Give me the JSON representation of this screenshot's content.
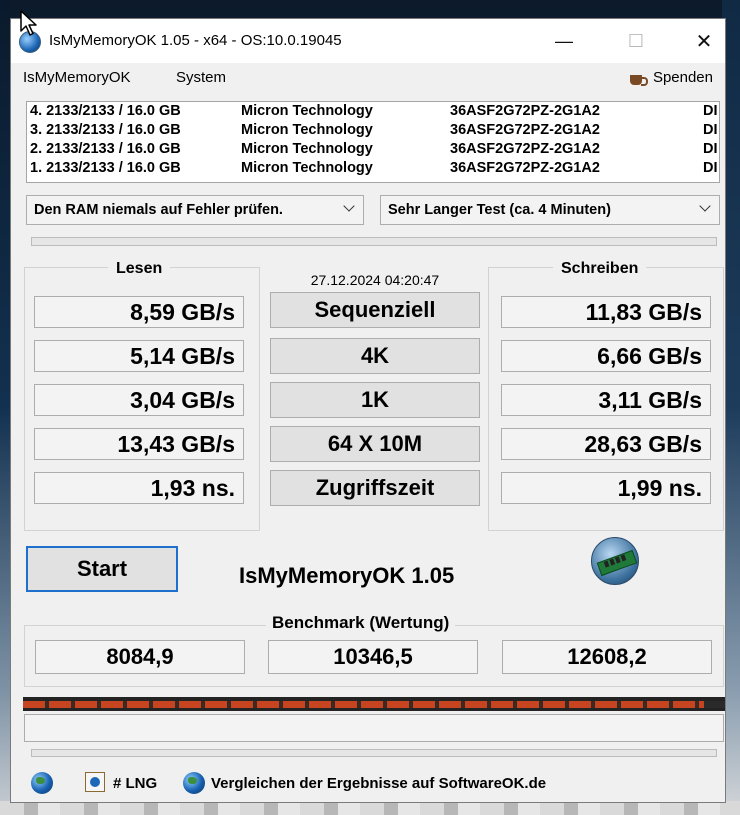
{
  "window": {
    "title": "IsMyMemoryOK 1.05 - x64 - OS:10.0.19045",
    "minimize": "—",
    "maximize": "☐",
    "close": "✕"
  },
  "menu": {
    "items": [
      "IsMyMemoryOK",
      "System"
    ],
    "donate": "Spenden"
  },
  "ram_modules": [
    {
      "slot": "4. 2133/2133 / 16.0 GB",
      "vendor": "Micron Technology",
      "part": "36ASF2G72PZ-2G1A2",
      "extra": "DI"
    },
    {
      "slot": "3. 2133/2133 / 16.0 GB",
      "vendor": "Micron Technology",
      "part": "36ASF2G72PZ-2G1A2",
      "extra": "DI"
    },
    {
      "slot": "2. 2133/2133 / 16.0 GB",
      "vendor": "Micron Technology",
      "part": "36ASF2G72PZ-2G1A2",
      "extra": "DI"
    },
    {
      "slot": "1. 2133/2133 / 16.0 GB",
      "vendor": "Micron Technology",
      "part": "36ASF2G72PZ-2G1A2",
      "extra": "DI"
    }
  ],
  "selects": {
    "error_check": "Den RAM niemals auf Fehler prüfen.",
    "test_length": "Sehr Langer Test (ca. 4 Minuten)"
  },
  "timestamp": "27.12.2024 04:20:47",
  "read": {
    "label": "Lesen",
    "values": [
      "8,59 GB/s",
      "5,14 GB/s",
      "3,04 GB/s",
      "13,43 GB/s",
      "1,93 ns."
    ]
  },
  "write": {
    "label": "Schreiben",
    "values": [
      "11,83 GB/s",
      "6,66 GB/s",
      "3,11 GB/s",
      "28,63 GB/s",
      "1,99 ns."
    ]
  },
  "tests": [
    "Sequenziell",
    "4K",
    "1K",
    "64 X 10M",
    "Zugriffszeit"
  ],
  "start_label": "Start",
  "app_name": "IsMyMemoryOK 1.05",
  "benchmark": {
    "label": "Benchmark (Wertung)",
    "values": [
      "8084,9",
      "10346,5",
      "12608,2"
    ]
  },
  "progress": {
    "led_fill_fraction": 0.97
  },
  "footer": {
    "lng": "# LNG",
    "compare": "Vergleichen der Ergebnisse auf SoftwareOK.de"
  },
  "colors": {
    "led": "#c74420",
    "focus": "#1f6fcf"
  },
  "icons": {
    "app": "memory-chip-globe-icon",
    "donate": "coffee-cup-icon",
    "footer_left": "globe-icon",
    "lng": "language-icon",
    "compare": "globe-icon"
  }
}
